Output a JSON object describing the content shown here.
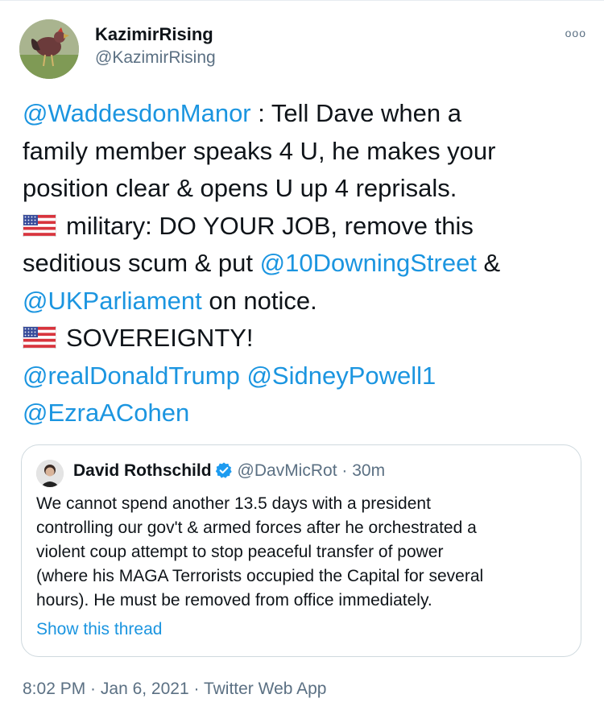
{
  "author": {
    "display_name": "KazimirRising",
    "handle": "@KazimirRising"
  },
  "more_label": "ooo",
  "tweet_lines": [
    {
      "segments": [
        {
          "text": "@WaddesdonManor",
          "type": "mention"
        },
        {
          "text": " : Tell Dave when a",
          "type": "text"
        }
      ]
    },
    {
      "segments": [
        {
          "text": "family member speaks 4 U, he makes your",
          "type": "text"
        }
      ]
    },
    {
      "segments": [
        {
          "text": "position clear & opens U up 4 reprisals.",
          "type": "text"
        }
      ]
    },
    {
      "flag": "us-flag-emoji",
      "segments": [
        {
          "text": "military:  DO YOUR JOB, remove this",
          "type": "text"
        }
      ]
    },
    {
      "segments": [
        {
          "text": "seditious scum & put ",
          "type": "text"
        },
        {
          "text": "@10DowningStreet",
          "type": "mention"
        },
        {
          "text": " &",
          "type": "text"
        }
      ]
    },
    {
      "segments": [
        {
          "text": "@UKParliament",
          "type": "mention"
        },
        {
          "text": " on notice.",
          "type": "text"
        }
      ]
    },
    {
      "flag": "us-flag-emoji",
      "segments": [
        {
          "text": "SOVEREIGNTY!",
          "type": "text"
        }
      ]
    },
    {
      "segments": [
        {
          "text": "@realDonaldTrump",
          "type": "mention"
        },
        {
          "text": " ",
          "type": "text"
        },
        {
          "text": "@SidneyPowell1",
          "type": "mention"
        }
      ]
    },
    {
      "segments": [
        {
          "text": "@EzraACohen",
          "type": "mention"
        }
      ]
    }
  ],
  "quoted_tweet": {
    "display_name": "David Rothschild",
    "handle": "@DavMicRot",
    "separator": " · ",
    "time": "30m",
    "text_lines": [
      "We cannot spend another 13.5 days with a president",
      "controlling our gov't & armed forces after he orchestrated a",
      "violent coup attempt to stop peaceful transfer of power",
      "(where his MAGA Terrorists occupied the Capital for several",
      "hours). He must be removed from office immediately."
    ],
    "show_thread_label": "Show this thread"
  },
  "timestamp": {
    "time": "8:02 PM",
    "date": "Jan 6, 2021",
    "source": "Twitter Web App",
    "separator": " · "
  },
  "colors": {
    "mention": "#1b95e0",
    "secondary_text": "#5b7083",
    "border": "#cfd9de",
    "verified": "#1d9bf0"
  }
}
